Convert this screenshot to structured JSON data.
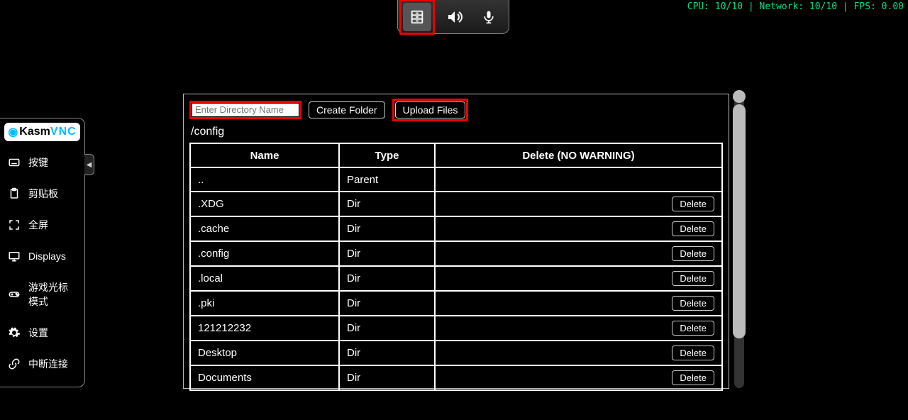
{
  "stats_text": "CPU: 10/10 | Network: 10/10 | FPS: 0.00",
  "toolbar": {
    "create_folder_label": "Create Folder",
    "upload_files_label": "Upload Files",
    "dir_input_placeholder": "Enter Directory Name"
  },
  "sidebar": {
    "logo_k": "K",
    "logo_asm": "asm",
    "logo_vnc": "VNC",
    "items": [
      {
        "label": "按键",
        "icon": "keyboard-icon"
      },
      {
        "label": "剪贴板",
        "icon": "clipboard-icon"
      },
      {
        "label": "全屏",
        "icon": "fullscreen-icon"
      },
      {
        "label": "Displays",
        "icon": "displays-icon"
      },
      {
        "label": "游戏光标模式",
        "icon": "gamepad-icon"
      },
      {
        "label": "设置",
        "icon": "gear-icon"
      },
      {
        "label": "中断连接",
        "icon": "disconnect-icon"
      }
    ]
  },
  "fm": {
    "path": "/config",
    "headers": {
      "name": "Name",
      "type": "Type",
      "delete": "Delete (NO WARNING)"
    },
    "delete_label": "Delete",
    "rows": [
      {
        "name": "..",
        "type": "Parent",
        "deletable": false
      },
      {
        "name": ".XDG",
        "type": "Dir",
        "deletable": true
      },
      {
        "name": ".cache",
        "type": "Dir",
        "deletable": true
      },
      {
        "name": ".config",
        "type": "Dir",
        "deletable": true
      },
      {
        "name": ".local",
        "type": "Dir",
        "deletable": true
      },
      {
        "name": ".pki",
        "type": "Dir",
        "deletable": true
      },
      {
        "name": "121212232",
        "type": "Dir",
        "deletable": true
      },
      {
        "name": "Desktop",
        "type": "Dir",
        "deletable": true
      },
      {
        "name": "Documents",
        "type": "Dir",
        "deletable": true
      }
    ]
  }
}
